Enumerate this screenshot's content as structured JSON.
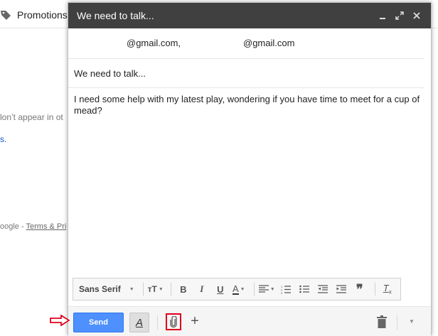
{
  "background": {
    "tab_label": "Promotions",
    "partial_text_1": "lon’t appear in ot",
    "partial_text_2": "s.",
    "footer_prefix": "oogle - ",
    "footer_link": "Terms & Pri"
  },
  "compose": {
    "title": "We need to talk...",
    "recipients": [
      "@gmail.com,",
      "@gmail.com"
    ],
    "subject": "We need to talk...",
    "body": "I need some help with my latest play, wondering if you have time to meet for a cup of mead?",
    "toolbar": {
      "font_label": "Sans Serif"
    },
    "send_label": "Send"
  },
  "colors": {
    "header_bg": "#404040",
    "send_blue": "#4d90fe",
    "annotation_red": "#e0001b"
  }
}
